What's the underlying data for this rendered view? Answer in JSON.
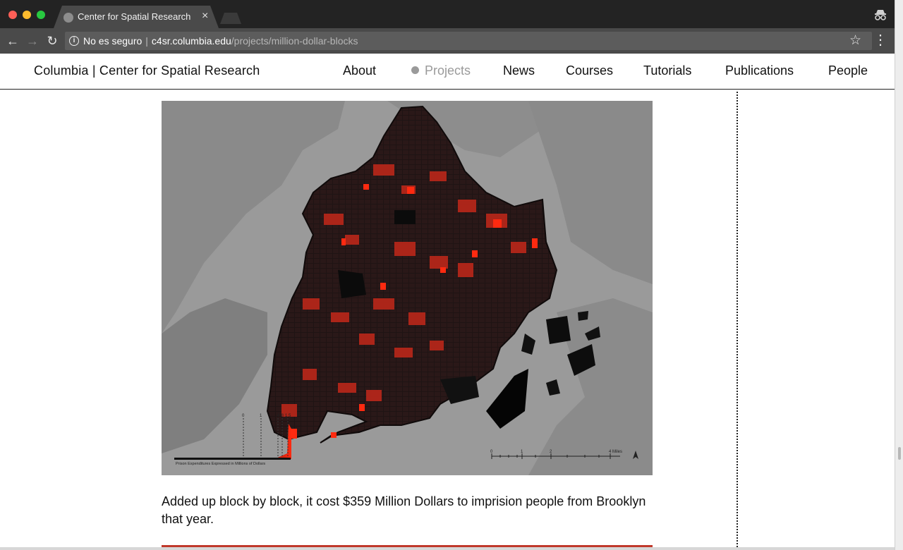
{
  "browser": {
    "tab_title": "Center for Spatial Research",
    "tab_close": "×",
    "address_insecure_label": "No es seguro",
    "address_separator": "|",
    "address_host": "c4sr.columbia.edu",
    "address_path": "/projects/million-dollar-blocks",
    "icons": [
      "back-arrow-icon",
      "forward-arrow-icon",
      "reload-icon",
      "info-icon",
      "star-icon",
      "menu-icon",
      "incognito-icon"
    ]
  },
  "site": {
    "title": "Columbia | Center for Spatial Research",
    "nav": [
      {
        "label": "About",
        "active": false
      },
      {
        "label": "Projects",
        "active": true
      },
      {
        "label": "News",
        "active": false
      },
      {
        "label": "Courses",
        "active": false
      },
      {
        "label": "Tutorials",
        "active": false
      },
      {
        "label": "Publications",
        "active": false
      },
      {
        "label": "People",
        "active": false
      }
    ]
  },
  "map": {
    "legend_ticks": [
      "0",
      "1",
      ".4",
      ".8",
      "1.5"
    ],
    "legend_caption": "Prison Expenditures Expressed in Millions of Dollars",
    "scale_ticks": [
      "0",
      "1",
      "2",
      "4 Miles"
    ],
    "colors": {
      "background": "#9a9a9a",
      "water": "#7f7f7f",
      "blocks": "#1c1111",
      "highlight": "#ff2a10",
      "mid": "#b3261a"
    }
  },
  "content": {
    "caption": "Added up block by block, it cost $359 Million Dollars to imprision people from Brooklyn that year."
  }
}
